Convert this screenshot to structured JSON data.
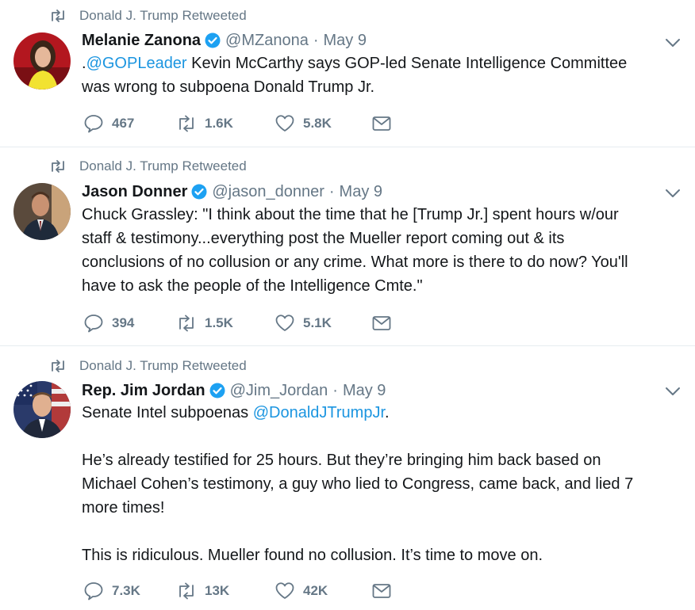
{
  "tweets": [
    {
      "retweet_label": "Donald J. Trump Retweeted",
      "name": "Melanie Zanona",
      "handle": "@MZanona",
      "sep": "·",
      "date": "May 9",
      "text_parts": [
        ".",
        "@GOPLeader",
        " Kevin McCarthy says GOP-led Senate Intelligence Committee\nwas wrong to subpoena Donald Trump Jr."
      ],
      "replies": "467",
      "retweets": "1.6K",
      "likes": "5.8K"
    },
    {
      "retweet_label": "Donald J. Trump Retweeted",
      "name": "Jason Donner",
      "handle": "@jason_donner",
      "sep": "·",
      "date": "May 9",
      "text": "Chuck Grassley: \"I think about the time that he [Trump Jr.] spent hours w/our\nstaff & testimony...everything post the Mueller report coming out & its\nconclusions of no collusion or any crime. What more is there to do now? You'll\nhave to ask the people of the Intelligence Cmte.\"",
      "replies": "394",
      "retweets": "1.5K",
      "likes": "5.1K"
    },
    {
      "retweet_label": "Donald J. Trump Retweeted",
      "name": "Rep. Jim Jordan",
      "handle": "@Jim_Jordan",
      "sep": "·",
      "date": "May 9",
      "text_parts": [
        "Senate Intel subpoenas ",
        "@DonaldJTrumpJr",
        "."
      ],
      "text_rest": "He’s already testified for 25 hours. But they’re bringing him back based on\nMichael Cohen’s testimony, a guy who lied to Congress, came back, and lied 7\nmore times!\n\nThis is ridiculous. Mueller found no collusion. It’s time to move on.",
      "replies": "7.3K",
      "retweets": "13K",
      "likes": "42K"
    }
  ],
  "icons": {
    "retweet": "retweet-icon",
    "verified": "verified-badge-icon",
    "caret": "chevron-down-icon",
    "reply": "reply-icon",
    "like": "heart-icon",
    "dm": "envelope-icon"
  },
  "colors": {
    "link": "#1b95e0",
    "secondary": "#657786",
    "verified": "#1da1f2",
    "divider": "#e6ecf0"
  }
}
